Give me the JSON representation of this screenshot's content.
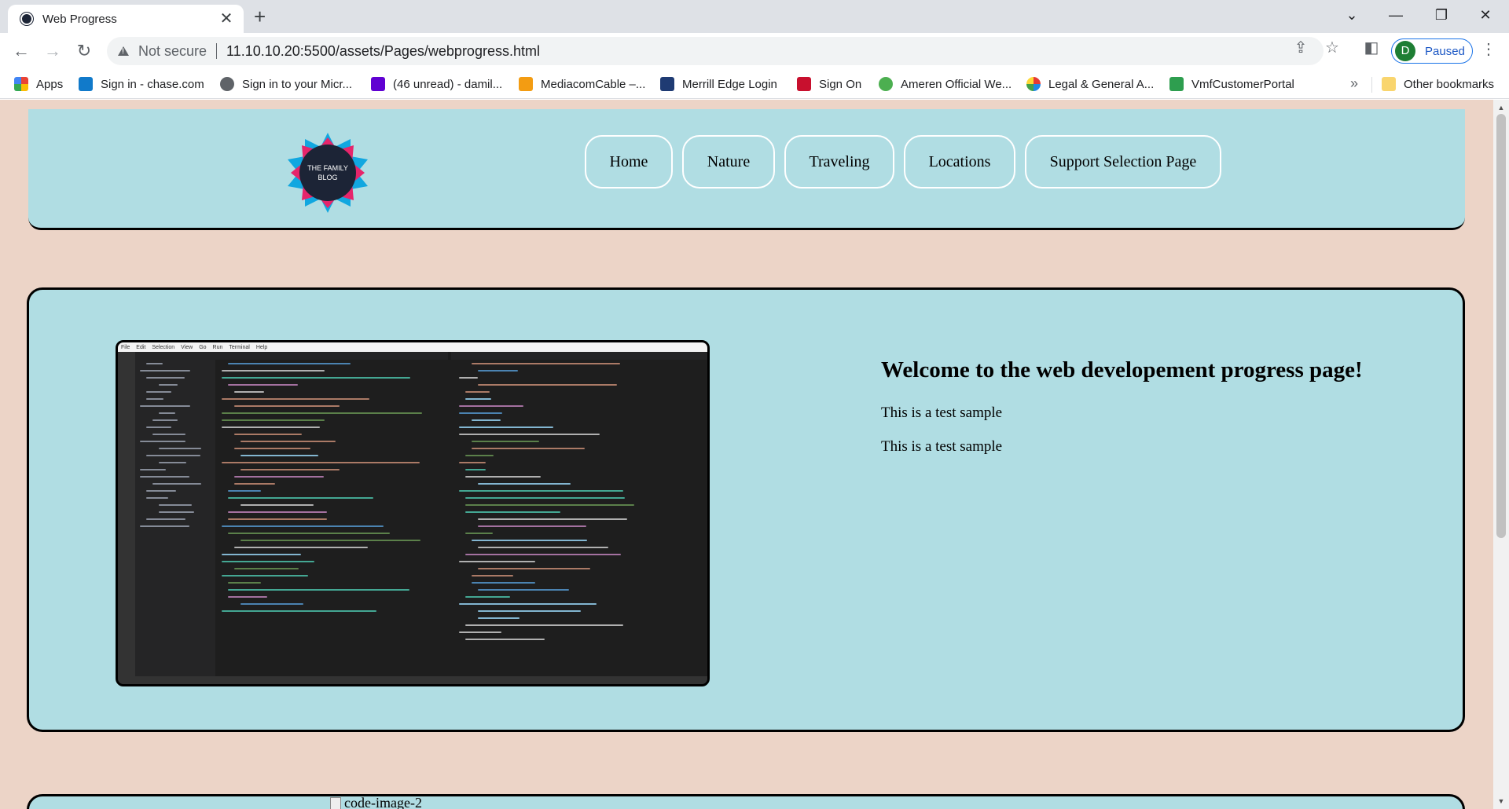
{
  "browser": {
    "tab_title": "Web Progress",
    "tab_close": "✕",
    "new_tab": "+",
    "window_controls": [
      "⌄",
      "—",
      "❐",
      "✕"
    ],
    "not_secure": "Not secure",
    "url": "11.10.10.20:5500/assets/Pages/webprogress.html",
    "profile_initial": "D",
    "profile_status": "Paused",
    "bookmarks": [
      {
        "label": "Apps",
        "icon": "apps-grid-icon",
        "color": "#4285f4"
      },
      {
        "label": "Sign in - chase.com",
        "icon": "chase-icon",
        "color": "#117aca"
      },
      {
        "label": "Sign in to your Micr...",
        "icon": "globe-icon",
        "color": "#5f6368"
      },
      {
        "label": "(46 unread) - damil...",
        "icon": "mail-icon",
        "color": "#6001d2"
      },
      {
        "label": "MediacomCable –...",
        "icon": "mediacom-icon",
        "color": "#f39c12"
      },
      {
        "label": "Merrill Edge Login",
        "icon": "merrill-icon",
        "color": "#1f3b73"
      },
      {
        "label": "Sign On",
        "icon": "principal-icon",
        "color": "#c8102e"
      },
      {
        "label": "Ameren Official We...",
        "icon": "ameren-icon",
        "color": "#4caf50"
      },
      {
        "label": "Legal & General A...",
        "icon": "legal-general-icon",
        "color": "#e53935"
      },
      {
        "label": "VmfCustomerPortal",
        "icon": "vmf-icon",
        "color": "#2e9e4f"
      }
    ],
    "bookmarks_more": "»",
    "other_bookmarks": "Other bookmarks"
  },
  "site": {
    "logo_text": "THE FAMILY BLOG",
    "menu": [
      "Home",
      "Nature",
      "Traveling",
      "Locations",
      "Support Selection Page"
    ],
    "welcome_heading": "Welcome to the web developement progress page!",
    "paragraph_1": "This is a test sample",
    "paragraph_2": "This is a test sample",
    "broken_image_alt": "code-image-2"
  },
  "vscode": {
    "menu": [
      "File",
      "Edit",
      "Selection",
      "View",
      "Go",
      "Run",
      "Terminal",
      "Help"
    ]
  },
  "colors": {
    "page_bg": "#ecd4c7",
    "panel_bg": "#b0dde3"
  }
}
